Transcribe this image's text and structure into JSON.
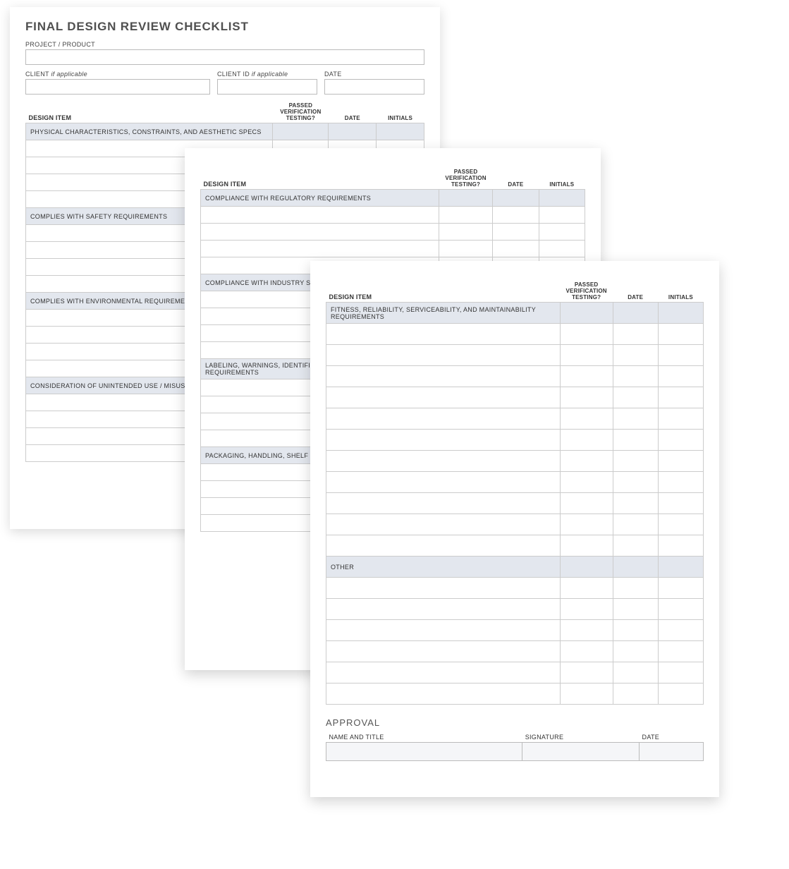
{
  "title": "FINAL DESIGN REVIEW CHECKLIST",
  "meta": {
    "project_label": "PROJECT / PRODUCT",
    "client_label": "CLIENT",
    "client_hint": "if applicable",
    "client_id_label": "CLIENT ID",
    "client_id_hint": "if applicable",
    "date_label": "DATE"
  },
  "columns": {
    "design_item": "DESIGN ITEM",
    "passed": "PASSED VERIFICATION TESTING?",
    "date": "DATE",
    "initials": "INITIALS"
  },
  "page1_sections": [
    {
      "label": "PHYSICAL CHARACTERISTICS, CONSTRAINTS, AND AESTHETIC SPECS",
      "rows": 4
    },
    {
      "label": "COMPLIES WITH SAFETY REQUIREMENTS",
      "rows": 4
    },
    {
      "label": "COMPLIES WITH ENVIRONMENTAL REQUIREMENTS",
      "rows": 4
    },
    {
      "label": "CONSIDERATION OF UNINTENDED USE / MISUSE",
      "rows": 4
    }
  ],
  "page2_sections": [
    {
      "label": "COMPLIANCE WITH REGULATORY REQUIREMENTS",
      "rows": 4
    },
    {
      "label": "COMPLIANCE WITH INDUSTRY STANDARDS",
      "rows": 4
    },
    {
      "label": "LABELING, WARNINGS, IDENTIFICATION, TRACEABILITY REQUIREMENTS",
      "rows": 4
    },
    {
      "label": "PACKAGING, HANDLING, SHELF LIFE, STORAGE REQUIREMENTS",
      "rows": 4
    }
  ],
  "page3_sections": [
    {
      "label": "FITNESS, RELIABILITY, SERVICEABILITY, AND MAINTAINABILITY REQUIREMENTS",
      "rows": 11
    },
    {
      "label": "OTHER",
      "rows": 6
    }
  ],
  "approval": {
    "heading": "APPROVAL",
    "name_title": "NAME AND TITLE",
    "signature": "SIGNATURE",
    "date": "DATE"
  }
}
